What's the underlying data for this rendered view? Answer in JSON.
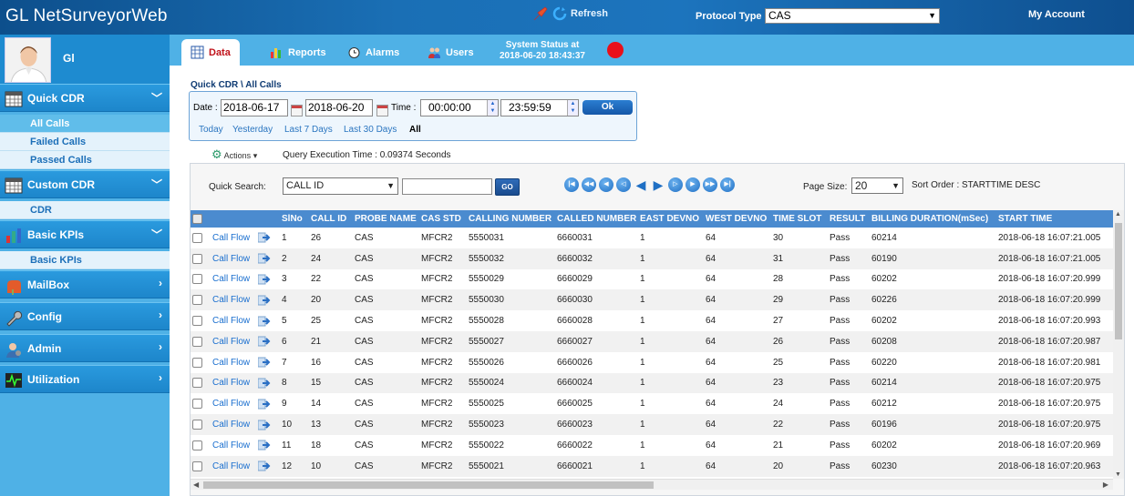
{
  "app": {
    "title": "GL NetSurveyorWeb",
    "refresh_label": "Refresh",
    "protocol_label": "Protocol Type",
    "protocol_value": "CAS",
    "account_label": "My Account"
  },
  "user": {
    "name": "Gl"
  },
  "sidebar": {
    "groups": [
      {
        "label": "Quick CDR",
        "icon": "calendar-table-icon",
        "chevron": "﹀",
        "items": [
          "All Calls",
          "Failed Calls",
          "Passed Calls"
        ]
      },
      {
        "label": "Custom CDR",
        "icon": "calendar-table-icon",
        "chevron": "﹀",
        "items": [
          "CDR"
        ]
      },
      {
        "label": "Basic KPIs",
        "icon": "bar-chart-icon",
        "chevron": "﹀",
        "items": [
          "Basic KPIs"
        ]
      },
      {
        "label": "MailBox",
        "icon": "mailbox-icon",
        "chevron": "›",
        "items": []
      },
      {
        "label": "Config",
        "icon": "wrench-icon",
        "chevron": "›",
        "items": []
      },
      {
        "label": "Admin",
        "icon": "admin-user-icon",
        "chevron": "›",
        "items": []
      },
      {
        "label": "Utilization",
        "icon": "pulse-monitor-icon",
        "chevron": "›",
        "items": []
      }
    ]
  },
  "tabs": [
    {
      "label": "Data",
      "icon": "table-icon",
      "active": true
    },
    {
      "label": "Reports",
      "icon": "bar-report-icon",
      "active": false
    },
    {
      "label": "Alarms",
      "icon": "alarm-clock-icon",
      "active": false
    },
    {
      "label": "Users",
      "icon": "users-icon",
      "active": false
    }
  ],
  "system_status": {
    "line1": "System Status at",
    "line2": "2018-06-20 18:43:37",
    "color": "#e8101a"
  },
  "breadcrumb": "Quick CDR \\ All Calls",
  "filter": {
    "date_label": "Date :",
    "date_from": "2018-06-17",
    "date_to": "2018-06-20",
    "time_label": "Time :",
    "time_from": "00:00:00",
    "time_to": "23:59:59",
    "ok_label": "Ok",
    "quick_ranges": [
      "Today",
      "Yesterday",
      "Last 7 Days",
      "Last 30 Days",
      "All"
    ],
    "selected_range": "All"
  },
  "actions_label": "Actions",
  "query_time": "Query Execution Time : 0.09374 Seconds",
  "grid": {
    "quick_search_label": "Quick Search:",
    "quick_search_field": "CALL ID",
    "quick_search_value": "",
    "go_label": "GO",
    "page_size_label": "Page Size:",
    "page_size": "20",
    "sort_order": "Sort Order : STARTTIME DESC",
    "columns": [
      "SlNo",
      "CALL ID",
      "PROBE NAME",
      "CAS STD",
      "CALLING NUMBER",
      "CALLED NUMBER",
      "EAST DEVNO",
      "WEST DEVNO",
      "TIME SLOT",
      "RESULT",
      "BILLING DURATION(mSec)",
      "START TIME"
    ],
    "link_label": "Call Flow",
    "rows": [
      [
        "1",
        "26",
        "CAS",
        "MFCR2",
        "5550031",
        "6660031",
        "1",
        "64",
        "30",
        "Pass",
        "60214",
        "2018-06-18 16:07:21.005"
      ],
      [
        "2",
        "24",
        "CAS",
        "MFCR2",
        "5550032",
        "6660032",
        "1",
        "64",
        "31",
        "Pass",
        "60190",
        "2018-06-18 16:07:21.005"
      ],
      [
        "3",
        "22",
        "CAS",
        "MFCR2",
        "5550029",
        "6660029",
        "1",
        "64",
        "28",
        "Pass",
        "60202",
        "2018-06-18 16:07:20.999"
      ],
      [
        "4",
        "20",
        "CAS",
        "MFCR2",
        "5550030",
        "6660030",
        "1",
        "64",
        "29",
        "Pass",
        "60226",
        "2018-06-18 16:07:20.999"
      ],
      [
        "5",
        "25",
        "CAS",
        "MFCR2",
        "5550028",
        "6660028",
        "1",
        "64",
        "27",
        "Pass",
        "60202",
        "2018-06-18 16:07:20.993"
      ],
      [
        "6",
        "21",
        "CAS",
        "MFCR2",
        "5550027",
        "6660027",
        "1",
        "64",
        "26",
        "Pass",
        "60208",
        "2018-06-18 16:07:20.987"
      ],
      [
        "7",
        "16",
        "CAS",
        "MFCR2",
        "5550026",
        "6660026",
        "1",
        "64",
        "25",
        "Pass",
        "60220",
        "2018-06-18 16:07:20.981"
      ],
      [
        "8",
        "15",
        "CAS",
        "MFCR2",
        "5550024",
        "6660024",
        "1",
        "64",
        "23",
        "Pass",
        "60214",
        "2018-06-18 16:07:20.975"
      ],
      [
        "9",
        "14",
        "CAS",
        "MFCR2",
        "5550025",
        "6660025",
        "1",
        "64",
        "24",
        "Pass",
        "60212",
        "2018-06-18 16:07:20.975"
      ],
      [
        "10",
        "13",
        "CAS",
        "MFCR2",
        "5550023",
        "6660023",
        "1",
        "64",
        "22",
        "Pass",
        "60196",
        "2018-06-18 16:07:20.975"
      ],
      [
        "11",
        "18",
        "CAS",
        "MFCR2",
        "5550022",
        "6660022",
        "1",
        "64",
        "21",
        "Pass",
        "60202",
        "2018-06-18 16:07:20.969"
      ],
      [
        "12",
        "10",
        "CAS",
        "MFCR2",
        "5550021",
        "6660021",
        "1",
        "64",
        "20",
        "Pass",
        "60230",
        "2018-06-18 16:07:20.963"
      ]
    ]
  }
}
